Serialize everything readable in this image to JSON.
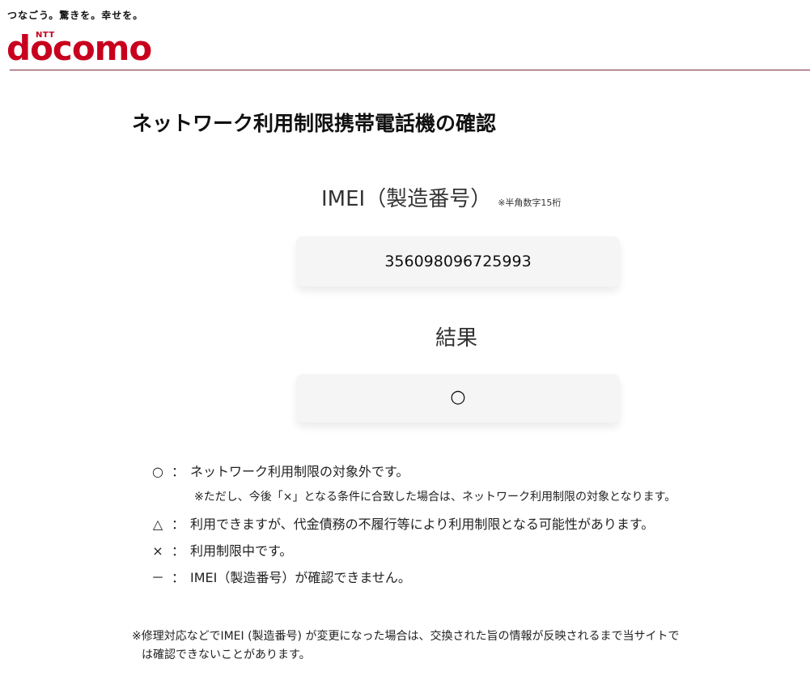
{
  "header": {
    "tagline": "つなごう。驚きを。幸せを。",
    "logo_ntt": "NTT",
    "logo_text": "docomo"
  },
  "page": {
    "title": "ネットワーク利用制限携帯電話機の確認"
  },
  "imei": {
    "label": "IMEI（製造番号）",
    "note": "※半角数字15桁",
    "value": "356098096725993"
  },
  "result": {
    "label": "結果",
    "value": "○"
  },
  "legend": [
    {
      "symbol": "○",
      "colon": "：",
      "text": "ネットワーク利用制限の対象外です。"
    },
    {
      "symbol": "△",
      "colon": "：",
      "text": "利用できますが、代金債務の不履行等により利用制限となる可能性があります。"
    },
    {
      "symbol": "×",
      "colon": "：",
      "text": "利用制限中です。"
    },
    {
      "symbol": "－",
      "colon": "：",
      "text": "IMEI（製造番号）が確認できません。"
    }
  ],
  "legend_sub": "※ただし、今後「×」となる条件に合致した場合は、ネットワーク利用制限の対象となります。",
  "footnote": {
    "line1": "※修理対応などでIMEI (製造番号) が変更になった場合は、交換された旨の情報が反映されるまで当サイトで",
    "line2": "は確認できないことがあります。"
  }
}
